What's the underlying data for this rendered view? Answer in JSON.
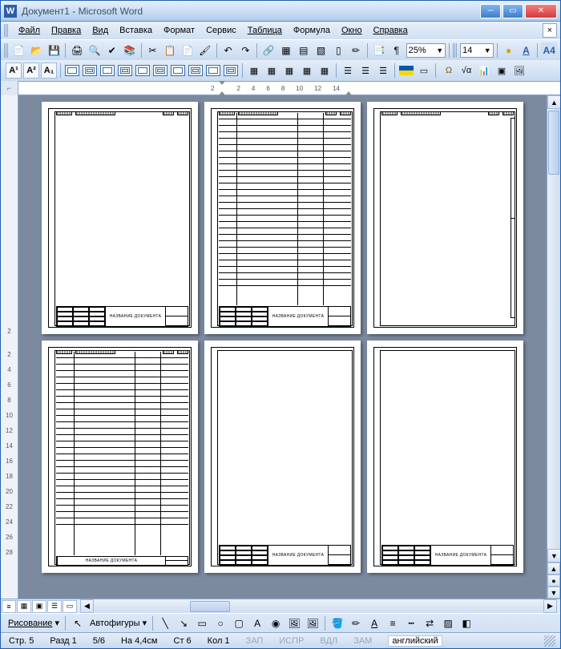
{
  "window": {
    "title": "Документ1 - Microsoft Word"
  },
  "menu": {
    "file": "Файл",
    "edit": "Правка",
    "view": "Вид",
    "insert": "Вставка",
    "format": "Формат",
    "service": "Сервис",
    "table": "Таблица",
    "formula": "Формула",
    "window": "Окно",
    "help": "Справка"
  },
  "toolbar": {
    "zoom": "25%",
    "font_size": "14"
  },
  "ruler": {
    "marks": [
      "2",
      "",
      "2",
      "4",
      "6",
      "8",
      "10",
      "12",
      "14"
    ]
  },
  "vruler": {
    "marks": [
      "2",
      "",
      "2",
      "4",
      "6",
      "8",
      "10",
      "12",
      "14",
      "16",
      "18",
      "20",
      "22",
      "24",
      "26",
      "28"
    ]
  },
  "stamp": {
    "doc_title": "НАЗВАНИЕ ДОКУМЕНТА"
  },
  "drawbar": {
    "drawing": "Рисование",
    "autoshapes": "Автофигуры"
  },
  "status": {
    "page": "Стр. 5",
    "section": "Разд 1",
    "pages": "5/6",
    "at": "На 4,4см",
    "line": "Ст 6",
    "col": "Кол 1",
    "rec": "ЗАП",
    "trk": "ИСПР",
    "ext": "ВДЛ",
    "ovr": "ЗАМ",
    "lang": "английский"
  }
}
